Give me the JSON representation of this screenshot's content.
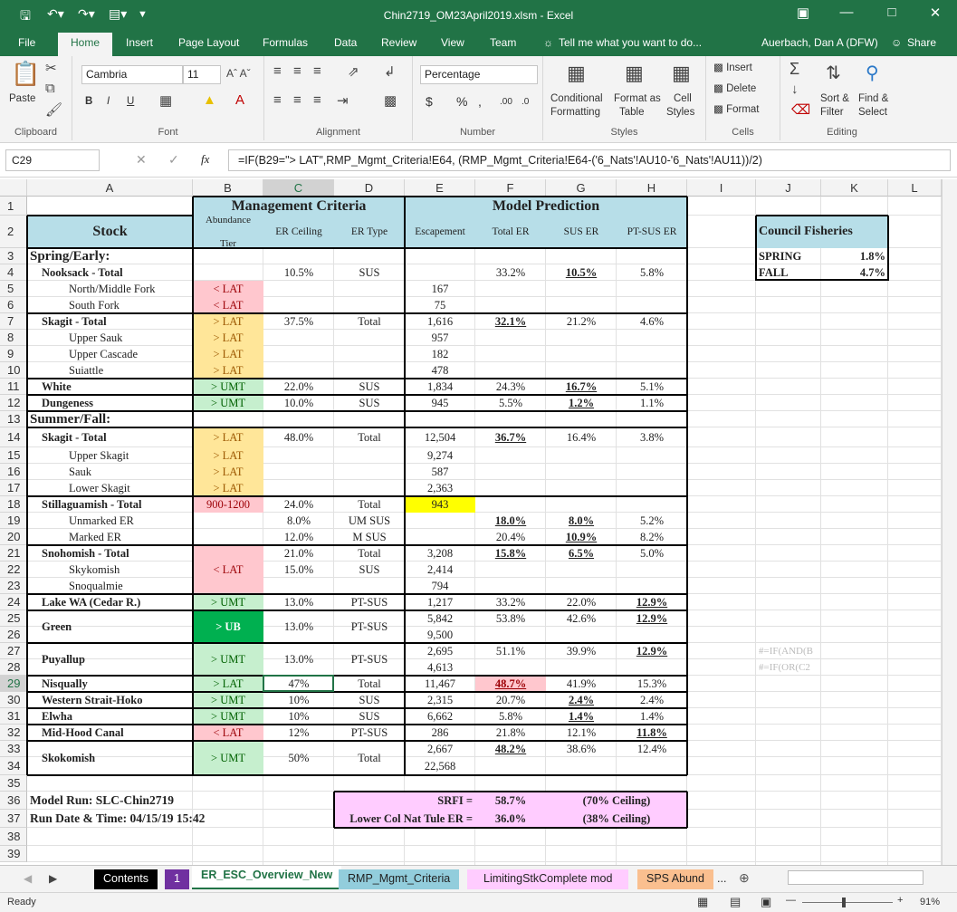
{
  "window": {
    "title": "Chin2719_OM23April2019.xlsm - Excel",
    "user": "Auerbach, Dan A (DFW)",
    "share": "Share"
  },
  "tabs": [
    "File",
    "Home",
    "Insert",
    "Page Layout",
    "Formulas",
    "Data",
    "Review",
    "View",
    "Team"
  ],
  "tellme": "Tell me what you want to do...",
  "ribbon": {
    "paste": "Paste",
    "clipboard": "Clipboard",
    "font_name": "Cambria",
    "font_size": "11",
    "font": "Font",
    "alignment": "Alignment",
    "number_format": "Percentage",
    "number": "Number",
    "cond1": "Conditional",
    "cond2": "Formatting",
    "fmt_as1": "Format as",
    "fmt_as2": "Table",
    "cell1": "Cell",
    "cell2": "Styles",
    "styles": "Styles",
    "insert": "Insert",
    "delete": "Delete",
    "format": "Format",
    "cells": "Cells",
    "sort1": "Sort &",
    "sort2": "Filter",
    "find1": "Find &",
    "find2": "Select",
    "editing": "Editing",
    "bold": "B",
    "italic": "I",
    "underline": "U",
    "dollar": "$",
    "pct": "%",
    "comma": ",",
    "inc_dec": ".00",
    "dec_dec": ".0"
  },
  "namebox": "C29",
  "fx": "fx",
  "formula": "=IF(B29=\"> LAT\",RMP_Mgmt_Criteria!E64, (RMP_Mgmt_Criteria!E64-('6_Nats'!AU10-'6_Nats'!AU11))/2)",
  "columns": [
    "A",
    "B",
    "C",
    "D",
    "E",
    "F",
    "G",
    "H",
    "I",
    "J",
    "K",
    "L"
  ],
  "rows": [
    "1",
    "2",
    "3",
    "4",
    "5",
    "6",
    "7",
    "8",
    "9",
    "10",
    "11",
    "12",
    "13",
    "14",
    "15",
    "16",
    "17",
    "18",
    "19",
    "20",
    "21",
    "22",
    "23",
    "24",
    "25",
    "26",
    "27",
    "28",
    "29",
    "30",
    "31",
    "32",
    "33",
    "34",
    "35",
    "36",
    "37",
    "38",
    "39"
  ],
  "headers": {
    "mgmt": "Management Criteria",
    "model": "Model Prediction",
    "stock": "Stock",
    "abund1": "Abundance",
    "abund2": "Tier",
    "er_ceiling": "ER Ceiling",
    "er_type": "ER Type",
    "escapement": "Escapement",
    "total_er": "Total ER",
    "sus_er": "SUS ER",
    "ptsus_er": "PT-SUS ER",
    "spring": "Spring/Early:",
    "summer": "Summer/Fall:"
  },
  "council": {
    "title": "Council Fisheries",
    "spring_label": "SPRING",
    "spring_val": "1.8%",
    "fall_label": "FALL",
    "fall_val": "4.7%"
  },
  "jcells": {
    "j27": "#=IF(AND(B",
    "j28": "#=IF(OR(C2"
  },
  "model_run": {
    "run": "Model Run: SLC-Chin2719",
    "date": "Run Date & Time:  04/15/19 15:42"
  },
  "srfi": {
    "l1": "SRFI =",
    "v1": "58.7%",
    "c1": "(70% Ceiling)",
    "l2": "Lower Col Nat Tule ER =",
    "v2": "36.0%",
    "c2": "(38% Ceiling)"
  },
  "table": [
    {
      "row": 4,
      "a": "Nooksack - Total",
      "ab": 1,
      "b": "",
      "c": "10.5%",
      "d": "SUS",
      "e": "",
      "f": "33.2%",
      "g": "10.5%",
      "h": "5.8%",
      "gu": 1
    },
    {
      "row": 5,
      "a": "North/Middle Fork",
      "ab": 0,
      "b": "< LAT",
      "bc": "pink",
      "c": "",
      "d": "",
      "e": "167",
      "f": "",
      "g": "",
      "h": ""
    },
    {
      "row": 6,
      "a": "South Fork",
      "ab": 0,
      "b": "< LAT",
      "bc": "pink",
      "c": "",
      "d": "",
      "e": "75",
      "f": "",
      "g": "",
      "h": ""
    },
    {
      "row": 7,
      "a": "Skagit - Total",
      "ab": 1,
      "b": "> LAT",
      "bc": "yellow",
      "c": "37.5%",
      "d": "Total",
      "e": "1,616",
      "f": "32.1%",
      "g": "21.2%",
      "h": "4.6%",
      "fu": 1
    },
    {
      "row": 8,
      "a": "Upper Sauk",
      "ab": 0,
      "b": "> LAT",
      "bc": "yellow",
      "c": "",
      "d": "",
      "e": "957",
      "f": "",
      "g": "",
      "h": ""
    },
    {
      "row": 9,
      "a": "Upper Cascade",
      "ab": 0,
      "b": "> LAT",
      "bc": "yellow",
      "c": "",
      "d": "",
      "e": "182",
      "f": "",
      "g": "",
      "h": ""
    },
    {
      "row": 10,
      "a": "Suiattle",
      "ab": 0,
      "b": "> LAT",
      "bc": "yellow",
      "c": "",
      "d": "",
      "e": "478",
      "f": "",
      "g": "",
      "h": ""
    },
    {
      "row": 11,
      "a": "White",
      "ab": 1,
      "b": "> UMT",
      "bc": "lgreen",
      "c": "22.0%",
      "d": "SUS",
      "e": "1,834",
      "f": "24.3%",
      "g": "16.7%",
      "h": "5.1%",
      "gu": 1
    },
    {
      "row": 12,
      "a": "Dungeness",
      "ab": 1,
      "b": "> UMT",
      "bc": "lgreen",
      "c": "10.0%",
      "d": "SUS",
      "e": "945",
      "f": "5.5%",
      "g": "1.2%",
      "h": "1.1%",
      "gu": 1
    },
    {
      "row": 14,
      "a": "Skagit  - Total",
      "ab": 1,
      "b": "> LAT",
      "bc": "yellow",
      "c": "48.0%",
      "d": "Total",
      "e": "12,504",
      "f": "36.7%",
      "g": "16.4%",
      "h": "3.8%",
      "fu": 1
    },
    {
      "row": 15,
      "a": "Upper Skagit",
      "ab": 0,
      "b": "> LAT",
      "bc": "yellow",
      "c": "",
      "d": "",
      "e": "9,274",
      "f": "",
      "g": "",
      "h": ""
    },
    {
      "row": 16,
      "a": "Sauk",
      "ab": 0,
      "b": "> LAT",
      "bc": "yellow",
      "c": "",
      "d": "",
      "e": "587",
      "f": "",
      "g": "",
      "h": ""
    },
    {
      "row": 17,
      "a": "Lower Skagit",
      "ab": 0,
      "b": "> LAT",
      "bc": "yellow",
      "c": "",
      "d": "",
      "e": "2,363",
      "f": "",
      "g": "",
      "h": ""
    },
    {
      "row": 18,
      "a": "Stillaguamish - Total",
      "ab": 1,
      "b": "900-1200",
      "bc": "pink",
      "c": "24.0%",
      "d": "Total",
      "e": "943",
      "ec": "yel",
      "f": "",
      "g": "",
      "h": ""
    },
    {
      "row": 19,
      "a": "Unmarked ER",
      "ab": 0,
      "b": "",
      "c": "8.0%",
      "d": "UM SUS",
      "e": "",
      "f": "18.0%",
      "g": "8.0%",
      "h": "5.2%",
      "fu": 1,
      "gu": 1
    },
    {
      "row": 20,
      "a": "Marked ER",
      "ab": 0,
      "b": "",
      "c": "12.0%",
      "d": "M SUS",
      "e": "",
      "f": "20.4%",
      "g": "10.9%",
      "h": "8.2%",
      "gu": 1
    },
    {
      "row": 21,
      "a": "Snohomish - Total",
      "ab": 1,
      "b": "",
      "c": "21.0%",
      "d": "Total",
      "e": "3,208",
      "f": "15.8%",
      "g": "6.5%",
      "h": "5.0%",
      "fu": 1,
      "gu": 1
    },
    {
      "row": 22,
      "a": "Skykomish",
      "ab": 0,
      "b": "< LAT",
      "c": "15.0%",
      "d": "SUS",
      "e": "2,414",
      "f": "",
      "g": "",
      "h": ""
    },
    {
      "row": 23,
      "a": "Snoqualmie",
      "ab": 0,
      "b": "",
      "c": "",
      "d": "",
      "e": "794",
      "f": "",
      "g": "",
      "h": ""
    },
    {
      "row": 24,
      "a": "Lake WA (Cedar R.)",
      "ab": 1,
      "b": "> UMT",
      "bc": "lgreen",
      "c": "13.0%",
      "d": "PT-SUS",
      "e": "1,217",
      "f": "33.2%",
      "g": "22.0%",
      "h": "12.9%",
      "hu": 1
    },
    {
      "row": 25,
      "a": "",
      "ab": 1,
      "b": "",
      "c": "",
      "d": "",
      "e": "5,842",
      "f": "53.8%",
      "g": "42.6%",
      "h": "12.9%",
      "hu": 1
    },
    {
      "row": 26,
      "a": "",
      "ab": 1,
      "b": "",
      "c": "",
      "d": "",
      "e": "9,500",
      "f": "",
      "g": "",
      "h": ""
    },
    {
      "row": 27,
      "a": "",
      "ab": 1,
      "b": "",
      "c": "",
      "d": "",
      "e": "2,695",
      "f": "51.1%",
      "g": "39.9%",
      "h": "12.9%",
      "hu": 1
    },
    {
      "row": 28,
      "a": "",
      "ab": 1,
      "b": "",
      "c": "",
      "d": "",
      "e": "4,613",
      "f": "",
      "g": "",
      "h": ""
    },
    {
      "row": 29,
      "a": "Nisqually",
      "ab": 1,
      "b": "> LAT",
      "bc": "lgreen",
      "c": "47%",
      "d": "Total",
      "e": "11,467",
      "f": "48.7%",
      "fc": "pinkcell",
      "g": "41.9%",
      "h": "15.3%",
      "fu": 1
    },
    {
      "row": 30,
      "a": "Western Strait-Hoko",
      "ab": 1,
      "b": "> UMT",
      "bc": "lgreen",
      "c": "10%",
      "d": "SUS",
      "e": "2,315",
      "f": "20.7%",
      "g": "2.4%",
      "h": "2.4%",
      "gu": 1
    },
    {
      "row": 31,
      "a": "Elwha",
      "ab": 1,
      "b": "> UMT",
      "bc": "lgreen",
      "c": "10%",
      "d": "SUS",
      "e": "6,662",
      "f": "5.8%",
      "g": "1.4%",
      "h": "1.4%",
      "gu": 1
    },
    {
      "row": 32,
      "a": "Mid-Hood Canal",
      "ab": 1,
      "b": "< LAT",
      "bc": "pink",
      "c": "12%",
      "d": "PT-SUS",
      "e": "286",
      "f": "21.8%",
      "g": "12.1%",
      "h": "11.8%",
      "hu": 1
    },
    {
      "row": 33,
      "a": "",
      "ab": 1,
      "b": "",
      "c": "",
      "d": "",
      "e": "2,667",
      "f": "48.2%",
      "g": "38.6%",
      "h": "12.4%",
      "fu": 1
    },
    {
      "row": 34,
      "a": "",
      "ab": 1,
      "b": "",
      "c": "",
      "d": "",
      "e": "22,568",
      "f": "",
      "g": "",
      "h": ""
    }
  ],
  "merged": {
    "green": {
      "a": "Green",
      "b": "> UB",
      "c": "13.0%",
      "d": "PT-SUS"
    },
    "puyallup": {
      "a": "Puyallup",
      "b": "> UMT",
      "c": "13.0%",
      "d": "PT-SUS"
    },
    "skokomish": {
      "a": "Skokomish",
      "b": "> UMT",
      "c": "50%",
      "d": "Total"
    },
    "snoho_b": "< LAT"
  },
  "sheet_tabs": [
    "Contents",
    "1",
    "ER_ESC_Overview_New",
    "RMP_Mgmt_Criteria",
    "LimitingStkComplete mod",
    "SPS Abund",
    "..."
  ],
  "status": {
    "ready": "Ready",
    "zoom": "91%"
  },
  "colors": {
    "excel_green": "#217346",
    "header_blue": "#b7dee8",
    "pink": "#ffc7ce",
    "yellow": "#ffe699",
    "lgreen": "#c6efce",
    "dgreen": "#00b050",
    "srfi": "#ffccff"
  }
}
